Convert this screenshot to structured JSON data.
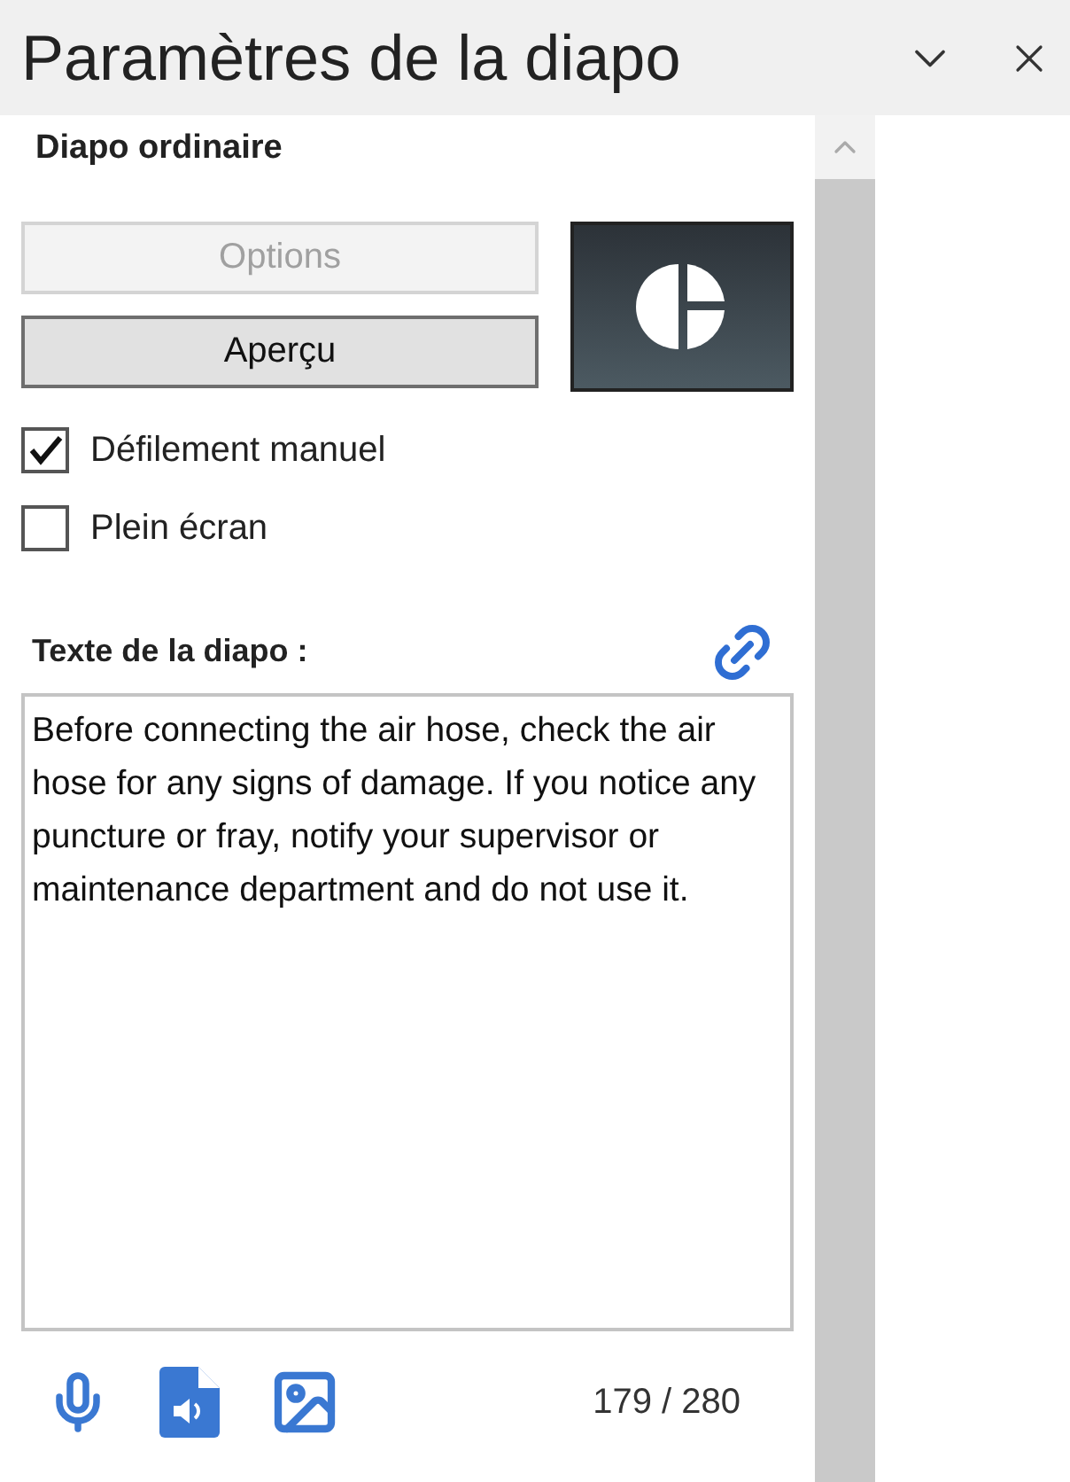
{
  "window": {
    "title": "Paramètres de la diapo"
  },
  "section": {
    "title": "Diapo ordinaire"
  },
  "buttons": [
    {
      "label": "Options",
      "disabled": true
    },
    {
      "label": "Aperçu",
      "disabled": false
    }
  ],
  "checkboxes": [
    {
      "label": "Défilement manuel",
      "checked": true
    },
    {
      "label": "Plein écran",
      "checked": false
    }
  ],
  "slide_text": {
    "label": "Texte de la diapo :",
    "value": "Before connecting the air hose, check the air hose for any signs of damage. If you notice any puncture or fray, notify your supervisor or maintenance department and do not use it."
  },
  "counter": "179 / 280"
}
